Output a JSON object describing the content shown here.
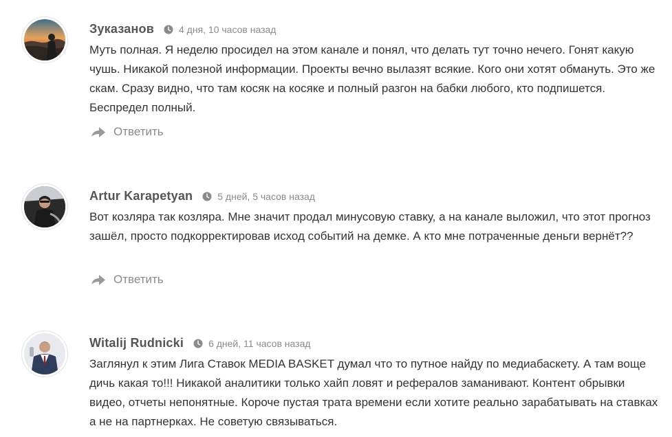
{
  "comments": [
    {
      "author": "Зуказанов",
      "time": "4 дня, 10 часов назад",
      "text": "Муть полная. Я неделю просидел на этом канале и понял, что делать тут точно нечего. Гонят какую чушь. Никакой полезной информации. Проекты вечно вылазят всякие. Кого они хотят обмануть. Это же скам. Сразу видно, что там косяк на косяке и полный разгон на бабки любого, кто подпишется. Беспредел полный.",
      "reply_label": "Ответить",
      "avatar_icon": "avatar-sunset-photo"
    },
    {
      "author": "Artur Karapetyan",
      "time": "5 дней, 5 часов назад",
      "text": "Вот козляра так козляра. Мне значит продал минусовую ставку, а на канале выложил, что этот прогноз зашёл, просто подкорректировав исход событий на демке. А кто мне потраченные деньги вернёт??",
      "reply_label": "Ответить",
      "avatar_icon": "avatar-car-photo"
    },
    {
      "author": "Witalij Rudnicki",
      "time": "6 дней, 11 часов назад",
      "text": "Заглянул к этим Лига Ставок MEDIA BASKET думал что то путное найду по медиабаскету. А там воще дичь какая то!!! Никакой аналитики только хайп ловят и рефералов заманивают. Контент обрывки видео, отчеты непонятные. Короче пустая трата времени если хотите реально зарабатывать на ставках а не на партнерках. Не советую связываться.",
      "reply_label": "",
      "avatar_icon": "avatar-man-photo"
    }
  ],
  "icons": {
    "time": "clock-icon",
    "reply": "reply-arrow-icon"
  },
  "colors": {
    "author": "#555555",
    "meta": "#8a8a8a",
    "text": "#333333",
    "reply": "#8a8a8a"
  }
}
